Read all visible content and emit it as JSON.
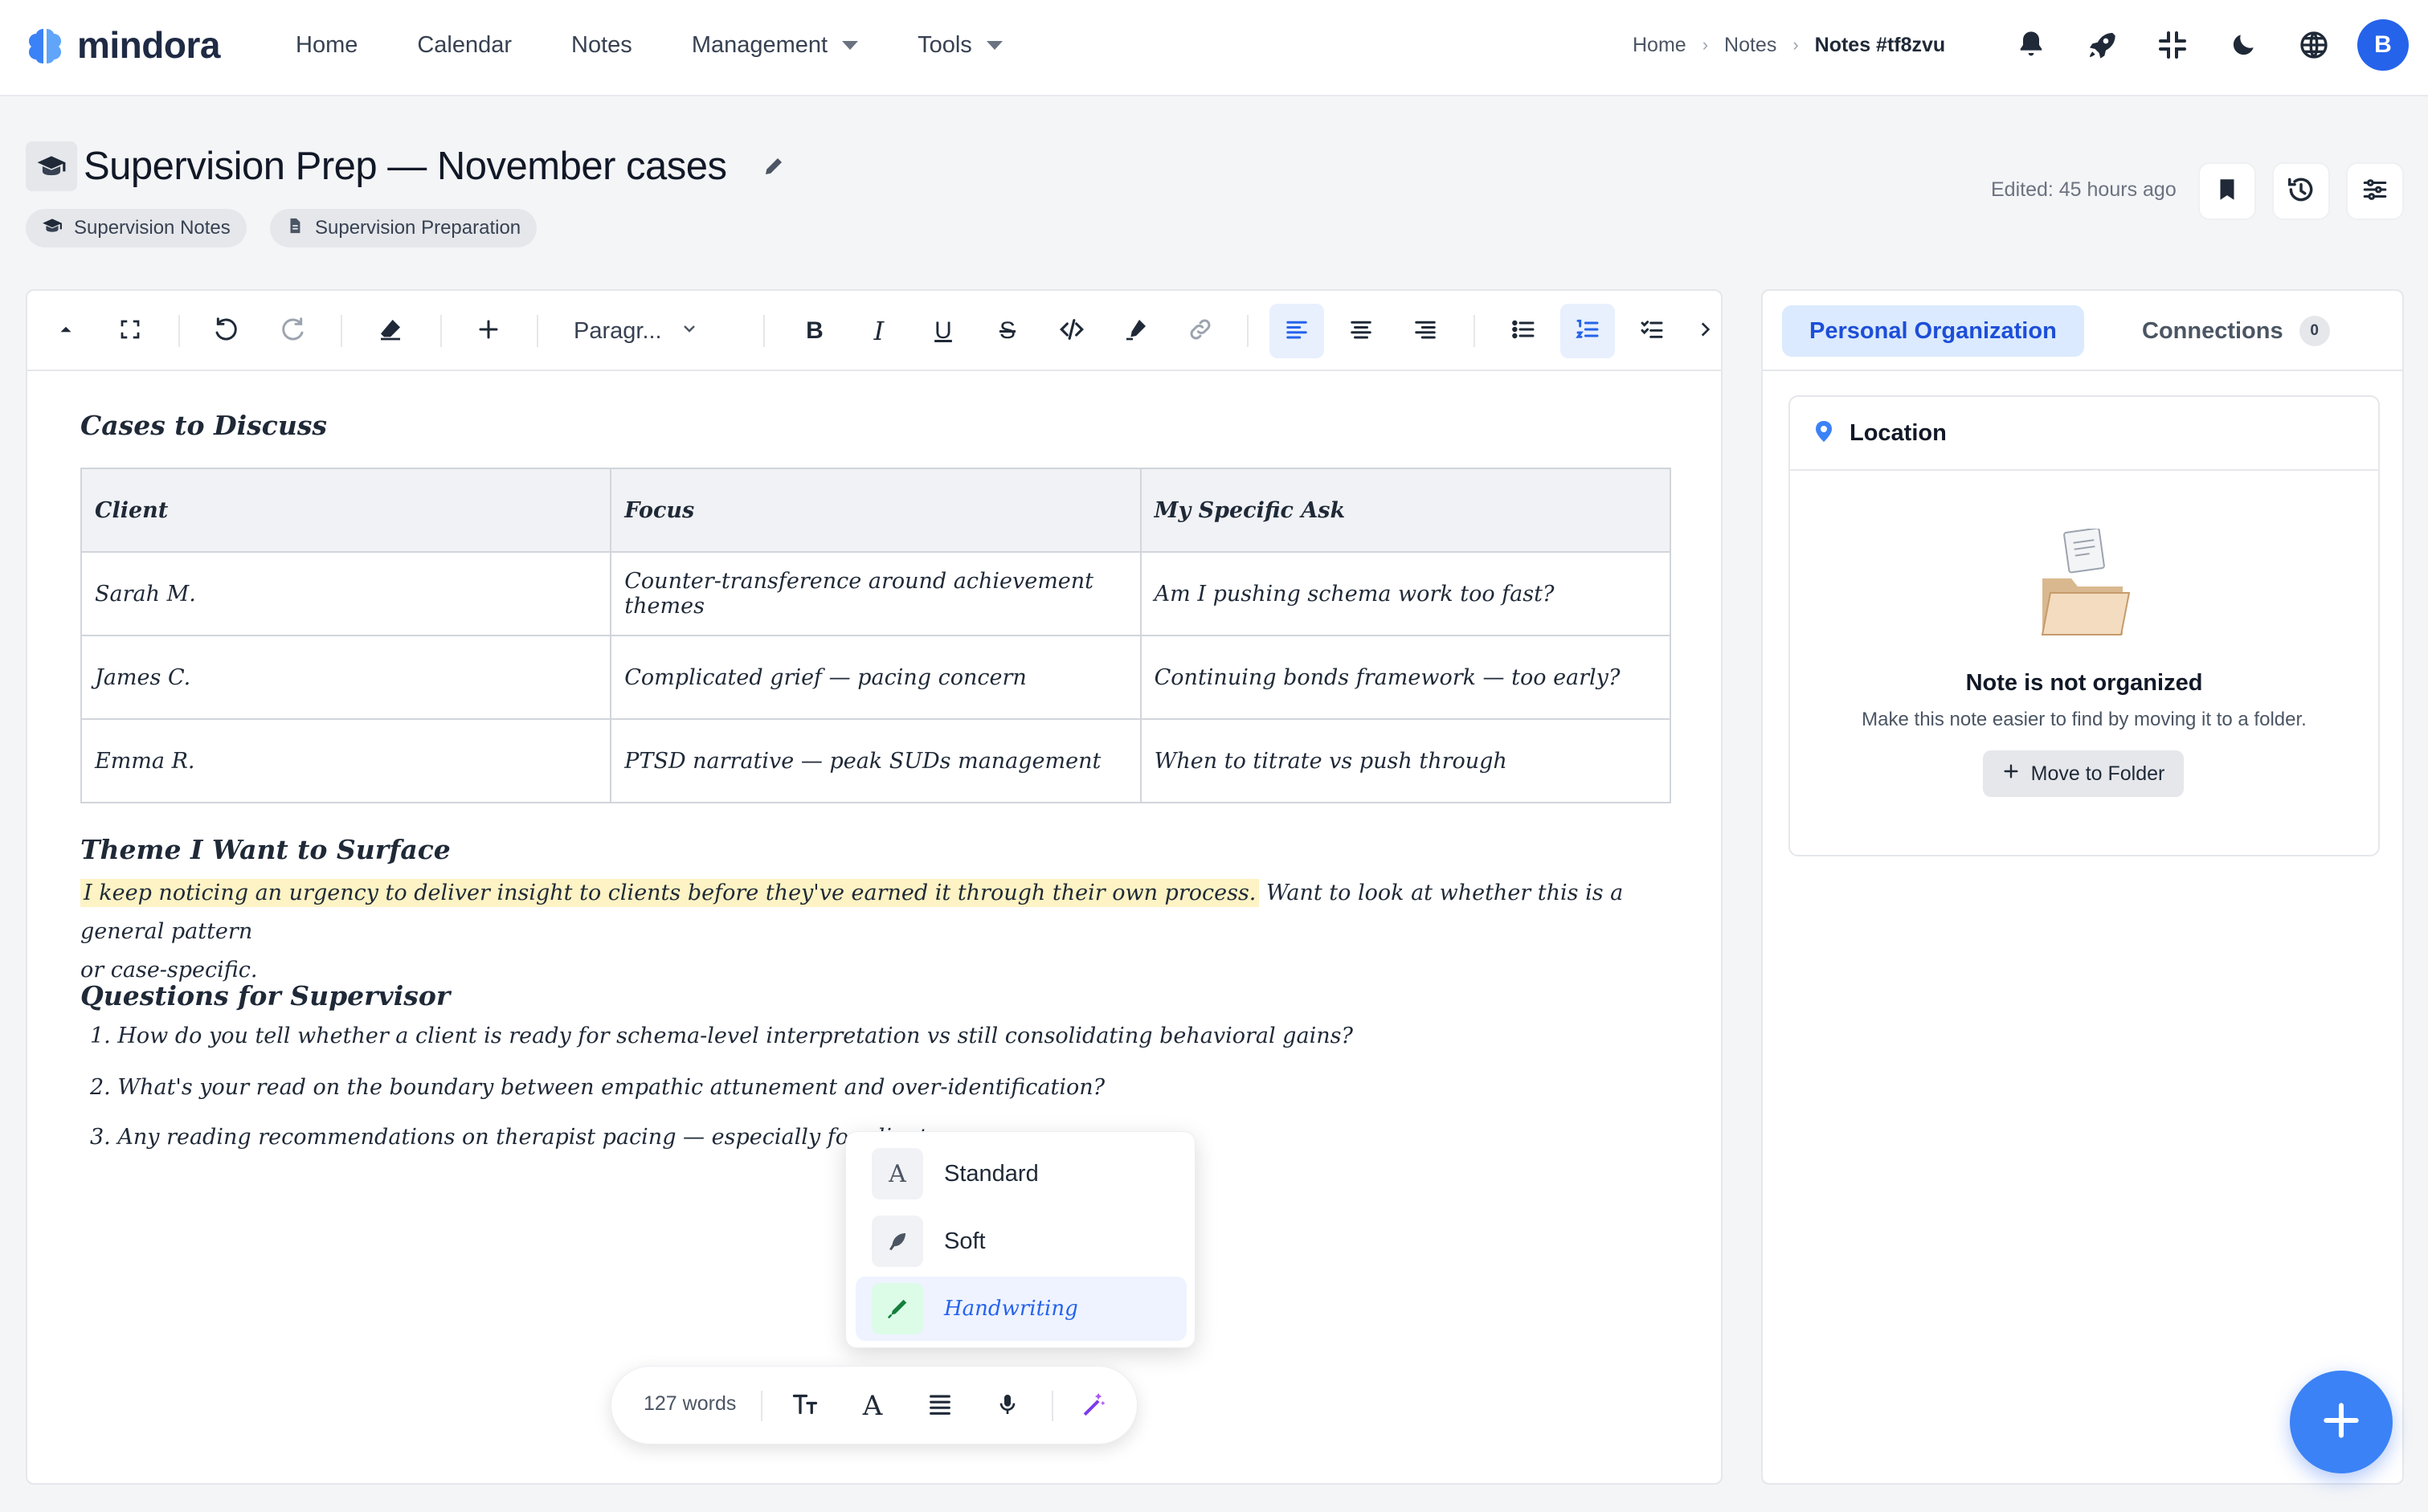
{
  "app": {
    "name": "mindora",
    "brand_color": "#3b82f6"
  },
  "nav": {
    "links": [
      {
        "label": "Home"
      },
      {
        "label": "Calendar"
      },
      {
        "label": "Notes"
      },
      {
        "label": "Management",
        "dropdown": true
      },
      {
        "label": "Tools",
        "dropdown": true
      }
    ],
    "breadcrumb": [
      "Home",
      "Notes",
      "Notes #tf8zvu"
    ],
    "icons": [
      "bell-icon",
      "rocket-icon",
      "collapse-icon",
      "moon-icon",
      "globe-icon"
    ],
    "avatar_initial": "B"
  },
  "note": {
    "title": "Supervision Prep — November cases",
    "tags": [
      "Supervision Notes",
      "Supervision Preparation"
    ],
    "edited": "Edited: 45 hours ago"
  },
  "toolbar": {
    "block_type": "Paragr...",
    "active_buttons": [
      "align-left",
      "ordered-list"
    ]
  },
  "content": {
    "h_cases": "Cases to Discuss",
    "table": {
      "headers": [
        "Client",
        "Focus",
        "My Specific Ask"
      ],
      "rows": [
        [
          "Sarah M.",
          "Counter-transference around achievement themes",
          "Am I pushing schema work too fast?"
        ],
        [
          "James C.",
          "Complicated grief — pacing concern",
          "Continuing bonds framework — too early?"
        ],
        [
          "Emma R.",
          "PTSD narrative — peak SUDs management",
          "When to titrate vs push through"
        ]
      ]
    },
    "h_theme": "Theme I Want to Surface",
    "theme_highlight": "I keep noticing an urgency to deliver insight to clients before they've earned it through their own process.",
    "theme_rest_line1": " Want to look at whether this is a general pattern",
    "theme_rest_line2": "or case-specific.",
    "h_questions": "Questions for Supervisor",
    "questions": [
      "How do you tell whether a client is ready for schema-level interpretation vs still consolidating behavioral gains?",
      "What's your read on the boundary between empathic attunement and over-identification?",
      "Any reading recommendations on therapist pacing — especially for clients"
    ]
  },
  "font_menu": {
    "options": [
      {
        "label": "Standard",
        "icon": "A"
      },
      {
        "label": "Soft",
        "icon": "feather-icon"
      },
      {
        "label": "Handwriting",
        "icon": "pen-icon",
        "selected": true
      }
    ]
  },
  "bottom_bar": {
    "word_count": "127 words"
  },
  "side": {
    "tabs": [
      {
        "label": "Personal Organization",
        "active": true
      },
      {
        "label": "Connections",
        "count": "0"
      }
    ],
    "location": {
      "title": "Location",
      "empty_title": "Note is not organized",
      "empty_sub": "Make this note easier to find by moving it to a folder.",
      "button": "Move to Folder"
    }
  }
}
